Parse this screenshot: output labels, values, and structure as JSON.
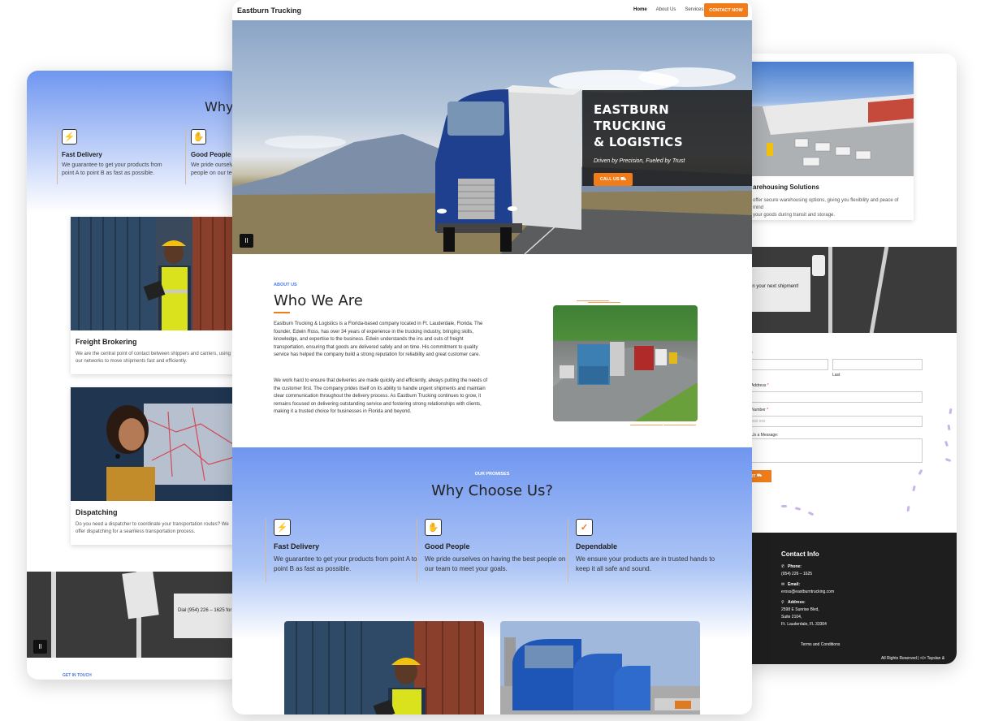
{
  "left_screen": {
    "why_title_partial": "Why C",
    "promises": [
      {
        "icon": "lightning-icon",
        "title": "Fast Delivery",
        "desc": "We guarantee to get your products from point A to point B as fast as possible."
      },
      {
        "icon": "handshake-icon",
        "title": "Good People",
        "desc": "We pride ourselv people on our te"
      }
    ],
    "cards": [
      {
        "title": "Freight Brokering",
        "desc": "We are the central point of contact between shippers and carriers, using our networks to move shipments fast and efficiently."
      },
      {
        "title": "Dispatching",
        "desc": "Do you need a dispatcher to coordinate your transportation routes? We offer dispatching for a seamless transportation process."
      }
    ],
    "dial_text": "Dial (954) 226 – 1625 for",
    "get_in_touch": "GET IN TOUCH",
    "pause": "II"
  },
  "right_screen": {
    "card": {
      "title": "arehousing Solutions",
      "desc_lines": [
        "offer secure warehousing options, giving you flexibility and peace of mind",
        "your goods during transit and storage."
      ]
    },
    "banner_text": "g on your next shipment!",
    "form": {
      "name_label": "*",
      "last_sub": "Last",
      "email_label": "Address",
      "phone_label": "Number",
      "phone_placeholder": "xxx xxx",
      "message_label": "Us a Message:",
      "submit": "MIT"
    },
    "footer": {
      "heading": "Contact Info",
      "phone_label": "Phone:",
      "phone": "(954) 226 – 1625",
      "email_label": "Email:",
      "email": "eross@eastburntrucking.com",
      "address_label": "Address:",
      "address_lines": [
        "2598 E Sunrise Blvd,",
        "Suite 2104,",
        "Ft. Lauderdale, FL 33304"
      ],
      "terms": "Terms and Conditions",
      "rights": "All Rights Reserved | </> Tayslan &"
    }
  },
  "center_screen": {
    "brand": "Eastburn Trucking",
    "nav": [
      "Home",
      "About Us",
      "Services"
    ],
    "cta": "CONTACT NOW",
    "hero": {
      "title_line1": "EASTBURN TRUCKING",
      "title_line2": "& LOGISTICS",
      "tagline": "Driven by Precision, Fueled by Trust",
      "button": "CALL US",
      "pause": "II"
    },
    "about": {
      "eyebrow": "ABOUT US",
      "title": "Who We Are",
      "para1": "Eastburn Trucking & Logistics is a Florida-based company located in Ft. Lauderdale, Florida. The founder, Edwin Ross, has over 34 years of experience in the trucking industry, bringing skills, knowledge, and expertise to the business. Edwin understands the ins and outs of freight transportation, ensuring that goods are delivered safely and on time. His commitment to quality service has helped the company build a strong reputation for reliability and great customer care.",
      "para2": "We work hard to ensure that deliveries are made quickly and efficiently, always putting the needs of the customer first. The company prides itself on its ability to handle urgent shipments and maintain clear communication throughout the delivery process. As Eastburn Trucking continues to grow, it remains focused on delivering outstanding service and fostering strong relationships with clients, making it a trusted choice for businesses in Florida and beyond."
    },
    "promises": {
      "eyebrow": "OUR PROMISES",
      "title": "Why Choose Us?",
      "items": [
        {
          "icon": "lightning-icon",
          "title": "Fast Delivery",
          "desc": "We guarantee to get your products from point A to point B as fast as possible."
        },
        {
          "icon": "handshake-icon",
          "title": "Good People",
          "desc": "We pride ourselves on having the best people on our team to meet your goals."
        },
        {
          "icon": "shield-check-icon",
          "title": "Dependable",
          "desc": "We ensure your products are in trusted hands to keep it all safe and sound."
        }
      ]
    }
  },
  "colors": {
    "accent": "#f07d1a",
    "blue": "#6f96f0",
    "eyebrow": "#4b7be6",
    "footer": "#1e1e1e"
  }
}
